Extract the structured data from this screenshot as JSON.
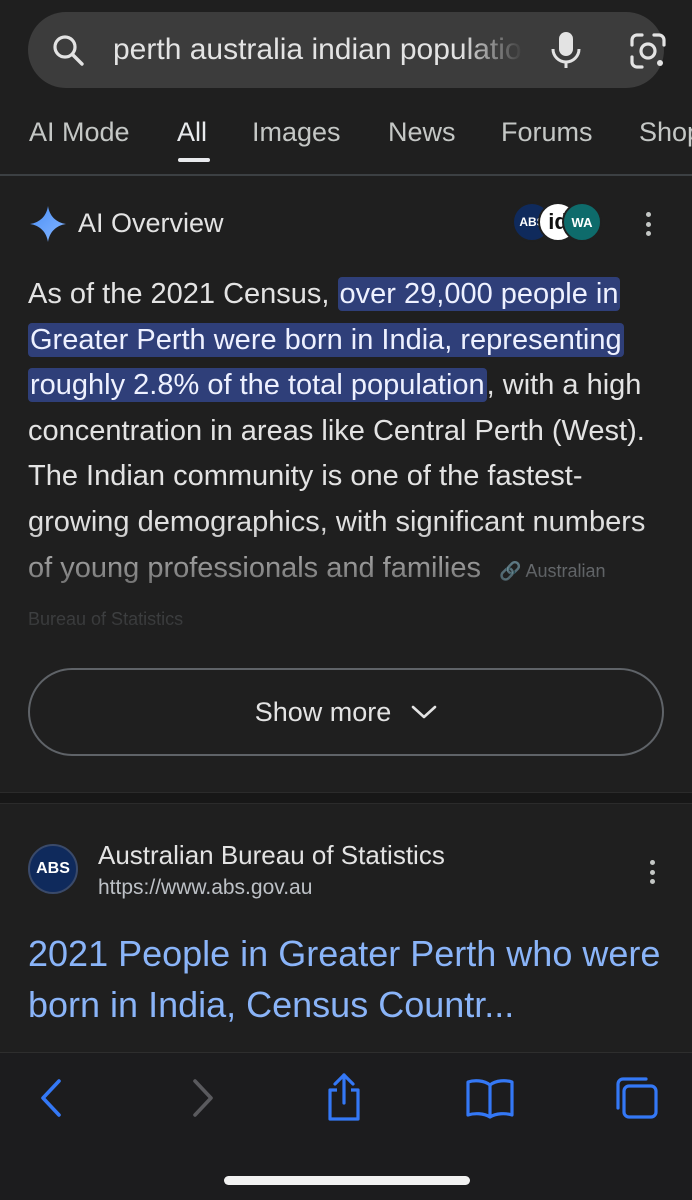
{
  "search": {
    "query": "perth australia indian population"
  },
  "tabs": [
    {
      "label": "AI Mode"
    },
    {
      "label": "All"
    },
    {
      "label": "Images"
    },
    {
      "label": "News"
    },
    {
      "label": "Forums"
    },
    {
      "label": "Shopping"
    }
  ],
  "active_tab": "All",
  "ai_overview": {
    "title": "AI Overview",
    "source_badges": [
      "ABS",
      "id",
      "WA"
    ],
    "text_before": "As of the 2021 Census, ",
    "highlighted": "over 29,000 people in Greater Perth were born in India, representing roughly 2.8% of the total population",
    "text_after": ", with a high concentration in areas like Central Perth (West). The Indian community is one of the fastest-growing demographics, with significant numbers of young professionals and families",
    "citation": "Australian Bureau of Statistics",
    "show_more_label": "Show more"
  },
  "result": {
    "favicon_text": "ABS",
    "site_name": "Australian Bureau of Statistics",
    "url": "https://www.abs.gov.au",
    "title": "2021 People in Greater Perth who were born in India, Census Countr..."
  },
  "colors": {
    "background": "#1f1f1f",
    "highlight": "#2f3f79",
    "link": "#8ab4f8",
    "ios_tint": "#3478f6"
  },
  "icons": {
    "search": "search-icon",
    "mic": "microphone-icon",
    "lens": "google-lens-icon",
    "sparkle": "gemini-sparkle-icon",
    "back": "back-chevron-icon",
    "forward": "forward-chevron-icon",
    "share": "share-icon",
    "bookmarks": "bookmarks-book-icon",
    "tabs": "tabs-icon"
  }
}
